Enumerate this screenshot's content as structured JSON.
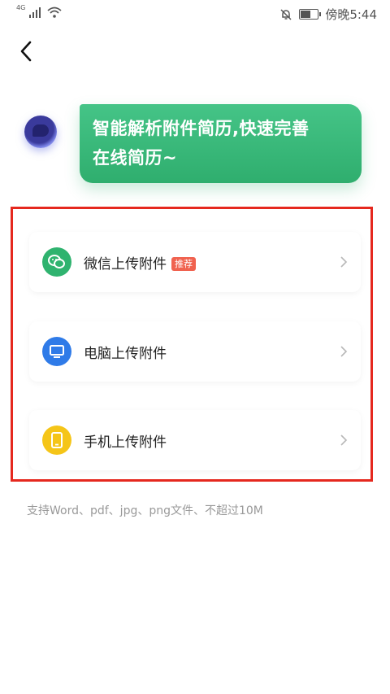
{
  "status_bar": {
    "network": "4G",
    "time": "傍晚5:44"
  },
  "assistant": {
    "message_line1": "智能解析附件简历,快速完善",
    "message_line2": "在线简历~"
  },
  "options": [
    {
      "label": "微信上传附件",
      "badge": "推荐",
      "icon": "wechat-icon",
      "color": "#2fb36f"
    },
    {
      "label": "电脑上传附件",
      "icon": "computer-icon",
      "color": "#2f7be8"
    },
    {
      "label": "手机上传附件",
      "icon": "phone-icon",
      "color": "#f5c518"
    }
  ],
  "hint": "支持Word、pdf、jpg、png文件、不超过10M",
  "colors": {
    "accent_green": "#2fae6e",
    "highlight_border": "#e5281e"
  }
}
